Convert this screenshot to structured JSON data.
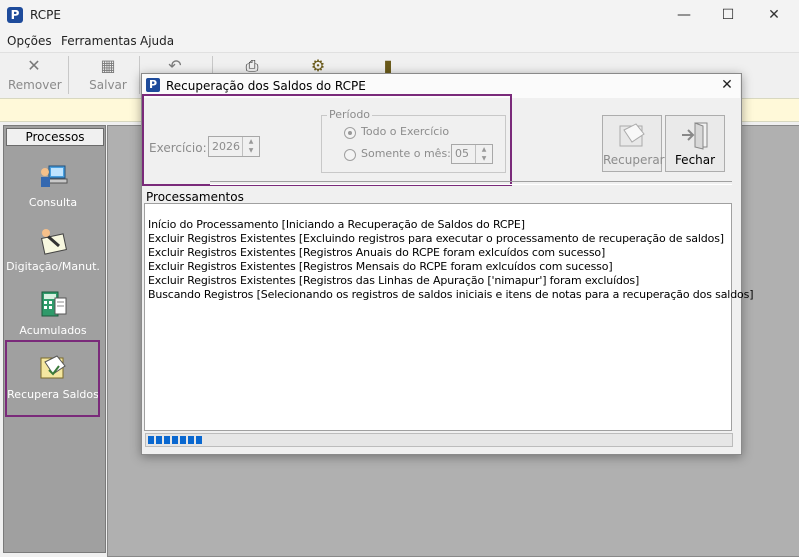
{
  "window": {
    "title": "RCPE",
    "icon": "p-logo-icon"
  },
  "menu": [
    "Opções",
    "Ferramentas",
    "Ajuda"
  ],
  "toolbar": {
    "remover": "Remover",
    "salvar": "Salvar"
  },
  "sidebar": {
    "header": "Processos",
    "items": [
      {
        "label": "Consulta",
        "icon": "computer-user-icon"
      },
      {
        "label": "Digitação/Manut.",
        "icon": "pen-notepad-icon"
      },
      {
        "label": "Acumulados",
        "icon": "calculator-icon"
      },
      {
        "label": "Recupera Saldos",
        "icon": "folder-recover-icon"
      }
    ]
  },
  "dialog": {
    "title": "Recuperação dos Saldos do RCPE",
    "exercicio_label": "Exercício:",
    "exercicio_value": "2026",
    "periodo_legend": "Período",
    "opt_todo": "Todo o Exercício",
    "opt_mes": "Somente o mês:",
    "mes_value": "05",
    "btn_recuperar": "Recuperar",
    "btn_fechar": "Fechar",
    "processamentos_label": "Processamentos",
    "log": [
      "Início do Processamento [Iniciando a Recuperação de Saldos do RCPE]",
      "Excluir Registros Existentes [Excluindo registros para executar o processamento de recuperação de saldos]",
      "Excluir Registros Existentes [Registros Anuais do RCPE foram exlcuídos com sucesso]",
      "Excluir Registros Existentes [Registros Mensais do RCPE foram exlcuídos com sucesso]",
      "Excluir Registros Existentes [Registros das Linhas de Apuração ['nimapur'] foram excluídos]",
      "Buscando Registros [Selecionando os registros de saldos iniciais e itens de notas para a recuperação dos saldos]"
    ],
    "progress_blocks": 7,
    "accent": "#0a68d0",
    "highlight": "#7a2a7a"
  }
}
